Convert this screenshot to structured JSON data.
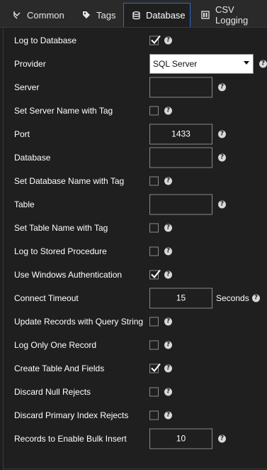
{
  "tabs": [
    {
      "label": "Common",
      "icon": "collapse-arrows-icon"
    },
    {
      "label": "Tags",
      "icon": "tag-icon"
    },
    {
      "label": "Database",
      "icon": "database-icon",
      "active": true
    },
    {
      "label": "CSV Logging",
      "icon": "csv-file-icon"
    }
  ],
  "form": {
    "log_to_database": {
      "label": "Log to Database",
      "checked": true
    },
    "provider": {
      "label": "Provider",
      "value": "SQL Server"
    },
    "server": {
      "label": "Server",
      "value": ""
    },
    "set_server_name_with_tag": {
      "label": "Set Server Name with Tag",
      "checked": false
    },
    "port": {
      "label": "Port",
      "value": "1433"
    },
    "database": {
      "label": "Database",
      "value": ""
    },
    "set_database_name_with_tag": {
      "label": "Set Database Name with Tag",
      "checked": false
    },
    "table": {
      "label": "Table",
      "value": ""
    },
    "set_table_name_with_tag": {
      "label": "Set Table Name with Tag",
      "checked": false
    },
    "log_to_stored_procedure": {
      "label": "Log to Stored Procedure",
      "checked": false
    },
    "use_windows_authentication": {
      "label": "Use Windows Authentication",
      "checked": true
    },
    "connect_timeout": {
      "label": "Connect Timeout",
      "value": "15",
      "unit": "Seconds"
    },
    "update_records_with_query_string": {
      "label": "Update Records with Query String",
      "checked": false
    },
    "log_only_one_record": {
      "label": "Log Only One Record",
      "checked": false
    },
    "create_table_and_fields": {
      "label": "Create Table And Fields",
      "checked": true
    },
    "discard_null_rejects": {
      "label": "Discard Null Rejects",
      "checked": false
    },
    "discard_primary_index_rejects": {
      "label": "Discard Primary Index Rejects",
      "checked": false
    },
    "records_to_enable_bulk_insert": {
      "label": "Records to Enable Bulk Insert",
      "value": "10"
    }
  },
  "help_glyph": "?",
  "colors": {
    "accent": "#2d6bcf",
    "background": "#1f1f1f",
    "text": "#ffffff"
  }
}
